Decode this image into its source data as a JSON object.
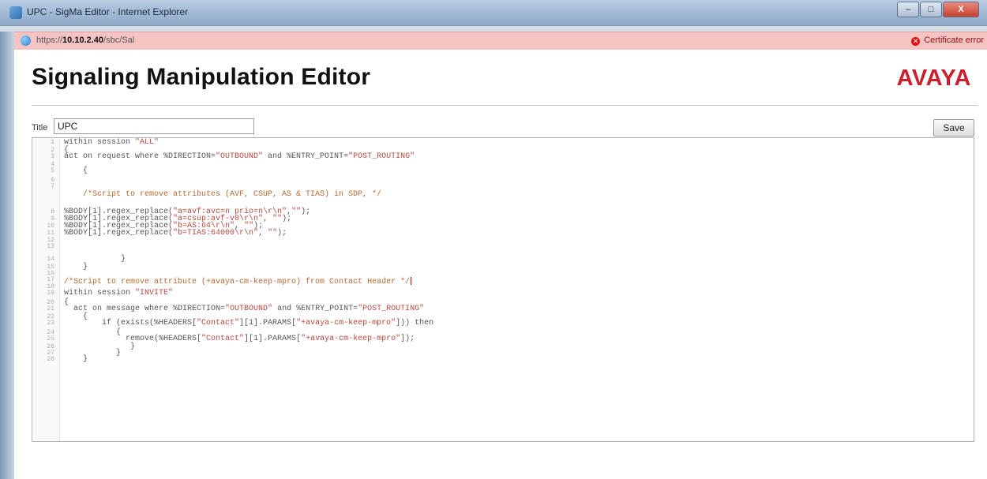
{
  "window": {
    "title": "UPC - SigMa Editor - Internet Explorer",
    "controls": [
      "–",
      "□",
      "X"
    ]
  },
  "address_bar": {
    "url_prefix": "https://",
    "host": "10.10.2.40",
    "path": "/sbc/Sal",
    "certificate_error": "Certificate error"
  },
  "page": {
    "heading": "Signaling Manipulation Editor",
    "logo_text": "AVAYA",
    "title_label": "Title",
    "title_value": "UPC",
    "save_label": "Save",
    "brand_color": "#cc1f2d"
  },
  "editor": {
    "lines": [
      {
        "n": "1",
        "text": "within session \"ALL\""
      },
      {
        "n": "2",
        "text": "{"
      },
      {
        "n": "3",
        "text": "act on request where %DIRECTION=\"OUTBOUND\" and %ENTRY_POINT=\"POST_ROUTING\""
      },
      {
        "n": "4",
        "text": ""
      },
      {
        "n": "5",
        "text": "    {"
      },
      {
        "n": "6",
        "text": ""
      },
      {
        "n": "7",
        "text": ""
      },
      {
        "n": "",
        "text": "    /*Script to remove attributes (AVF, CSUP, AS & TIAS) in SDP, */"
      },
      {
        "n": "",
        "text": ""
      },
      {
        "n": "8",
        "text": "%BODY[1].regex_replace(\"a=avf:avc=n prio=n\\r\\n\",\"\");"
      },
      {
        "n": "9",
        "text": "%BODY[1].regex_replace(\"a=csup:avf-v0\\r\\n\", \"\");"
      },
      {
        "n": "10",
        "text": "%BODY[1].regex_replace(\"b=AS:64\\r\\n\", \"\");"
      },
      {
        "n": "11",
        "text": "%BODY[1].regex_replace(\"b=TIAS:64000\\r\\n\", \"\");"
      },
      {
        "n": "12",
        "text": ""
      },
      {
        "n": "13",
        "text": ""
      },
      {
        "n": "",
        "text": ""
      },
      {
        "n": "14",
        "text": "            }"
      },
      {
        "n": "15",
        "text": "    }"
      },
      {
        "n": "16",
        "text": ""
      },
      {
        "n": "17",
        "text": "/*Script to remove attribute (+avaya-cm-keep-mpro) from Contact Header */"
      },
      {
        "n": "18",
        "text": ""
      },
      {
        "n": "19",
        "text": "within session \"INVITE\""
      },
      {
        "n": "20",
        "text": "{"
      },
      {
        "n": "21",
        "text": "  act on message where %DIRECTION=\"OUTBOUND\" and %ENTRY_POINT=\"POST_ROUTING\""
      },
      {
        "n": "22",
        "text": "    {"
      },
      {
        "n": "23",
        "text": "        if (exists(%HEADERS[\"Contact\"][1].PARAMS[\"+avaya-cm-keep-mpro\"])) then"
      },
      {
        "n": "24",
        "text": "           {"
      },
      {
        "n": "25",
        "text": "             remove(%HEADERS[\"Contact\"][1].PARAMS[\"+avaya-cm-keep-mpro\"]);"
      },
      {
        "n": "26",
        "text": "              }"
      },
      {
        "n": "27",
        "text": "           }"
      },
      {
        "n": "28",
        "text": "    }"
      }
    ]
  }
}
